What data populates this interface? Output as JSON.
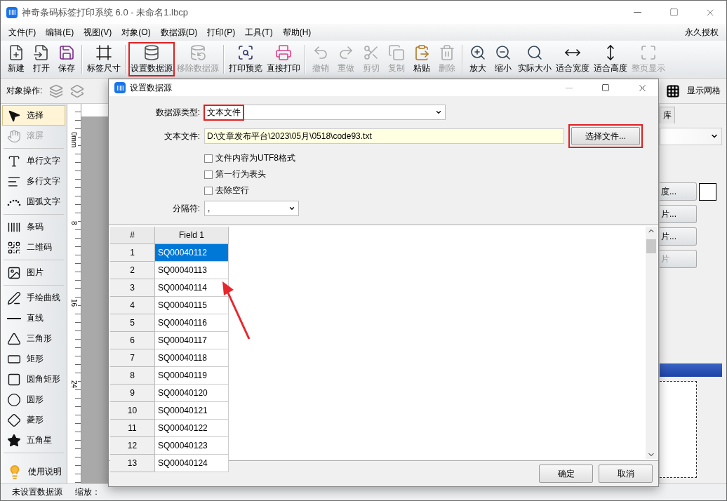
{
  "window": {
    "title": "神奇条码标签打印系统 6.0 - 未命名1.lbcp"
  },
  "menu": [
    "文件(F)",
    "编辑(E)",
    "视图(V)",
    "对象(O)",
    "数据源(D)",
    "打印(P)",
    "工具(T)",
    "帮助(H)"
  ],
  "license": "永久授权",
  "toolbar": [
    {
      "label": "新建",
      "disabled": false,
      "highlighted": false,
      "separator_before": false
    },
    {
      "label": "打开",
      "disabled": false,
      "highlighted": false,
      "separator_before": false
    },
    {
      "label": "保存",
      "disabled": false,
      "highlighted": false,
      "separator_before": false
    },
    {
      "label": "标签尺寸",
      "disabled": false,
      "highlighted": false,
      "separator_before": true
    },
    {
      "label": "设置数据源",
      "disabled": false,
      "highlighted": true,
      "separator_before": true
    },
    {
      "label": "移除数据源",
      "disabled": true,
      "highlighted": false,
      "separator_before": false
    },
    {
      "label": "打印预览",
      "disabled": false,
      "highlighted": false,
      "separator_before": true
    },
    {
      "label": "直接打印",
      "disabled": false,
      "highlighted": false,
      "separator_before": false
    },
    {
      "label": "撤销",
      "disabled": true,
      "highlighted": false,
      "separator_before": true
    },
    {
      "label": "重做",
      "disabled": true,
      "highlighted": false,
      "separator_before": false
    },
    {
      "label": "剪切",
      "disabled": true,
      "highlighted": false,
      "separator_before": false
    },
    {
      "label": "复制",
      "disabled": true,
      "highlighted": false,
      "separator_before": false
    },
    {
      "label": "粘贴",
      "disabled": false,
      "highlighted": false,
      "separator_before": false
    },
    {
      "label": "删除",
      "disabled": true,
      "highlighted": false,
      "separator_before": false
    },
    {
      "label": "放大",
      "disabled": false,
      "highlighted": false,
      "separator_before": true
    },
    {
      "label": "缩小",
      "disabled": false,
      "highlighted": false,
      "separator_before": false
    },
    {
      "label": "实际大小",
      "disabled": false,
      "highlighted": false,
      "separator_before": false
    },
    {
      "label": "适合宽度",
      "disabled": false,
      "highlighted": false,
      "separator_before": false
    },
    {
      "label": "适合高度",
      "disabled": false,
      "highlighted": false,
      "separator_before": false
    },
    {
      "label": "整页显示",
      "disabled": true,
      "highlighted": false,
      "separator_before": false
    }
  ],
  "object_bar": {
    "label": "对象操作:",
    "grid_toggle": "显示网格"
  },
  "tools": [
    {
      "label": "选择",
      "selected": true,
      "disabled": false,
      "separator_before": false
    },
    {
      "label": "滚屏",
      "selected": false,
      "disabled": true,
      "separator_before": false
    },
    {
      "label": "单行文字",
      "selected": false,
      "disabled": false,
      "separator_before": true
    },
    {
      "label": "多行文字",
      "selected": false,
      "disabled": false,
      "separator_before": false
    },
    {
      "label": "圆弧文字",
      "selected": false,
      "disabled": false,
      "separator_before": false
    },
    {
      "label": "条码",
      "selected": false,
      "disabled": false,
      "separator_before": true
    },
    {
      "label": "二维码",
      "selected": false,
      "disabled": false,
      "separator_before": false
    },
    {
      "label": "图片",
      "selected": false,
      "disabled": false,
      "separator_before": true
    },
    {
      "label": "手绘曲线",
      "selected": false,
      "disabled": false,
      "separator_before": true
    },
    {
      "label": "直线",
      "selected": false,
      "disabled": false,
      "separator_before": false
    },
    {
      "label": "三角形",
      "selected": false,
      "disabled": false,
      "separator_before": false
    },
    {
      "label": "矩形",
      "selected": false,
      "disabled": false,
      "separator_before": false
    },
    {
      "label": "圆角矩形",
      "selected": false,
      "disabled": false,
      "separator_before": false
    },
    {
      "label": "圆形",
      "selected": false,
      "disabled": false,
      "separator_before": false
    },
    {
      "label": "菱形",
      "selected": false,
      "disabled": false,
      "separator_before": false
    },
    {
      "label": "五角星",
      "selected": false,
      "disabled": false,
      "separator_before": false
    }
  ],
  "help": "使用说明",
  "ruler_labels": [
    "0mm",
    "8",
    "16",
    "24"
  ],
  "right_panel": {
    "tab": "库",
    "buttons": [
      {
        "label": "度...",
        "disabled": false
      },
      {
        "label": "片...",
        "disabled": false
      },
      {
        "label": "片...",
        "disabled": false
      },
      {
        "label": "片",
        "disabled": true
      }
    ]
  },
  "dialog": {
    "title": "设置数据源",
    "type_label": "数据源类型:",
    "type_value": "文本文件",
    "type_highlighted": true,
    "file_label": "文本文件:",
    "file_path": "D:\\文章发布平台\\2023\\05月\\0518\\code93.txt",
    "choose_button": {
      "label": "选择文件...",
      "highlighted": true
    },
    "options": [
      {
        "label": "文件内容为UTF8格式",
        "checked": false
      },
      {
        "label": "第一行为表头",
        "checked": false
      },
      {
        "label": "去除空行",
        "checked": false
      }
    ],
    "separator_label": "分隔符:",
    "separator_value": ",",
    "table": {
      "columns": [
        "#",
        "Field 1"
      ],
      "rows": [
        {
          "index": "1",
          "value": "SQ00040112",
          "selected": true
        },
        {
          "index": "2",
          "value": "SQ00040113",
          "selected": false
        },
        {
          "index": "3",
          "value": "SQ00040114",
          "selected": false
        },
        {
          "index": "4",
          "value": "SQ00040115",
          "selected": false
        },
        {
          "index": "5",
          "value": "SQ00040116",
          "selected": false
        },
        {
          "index": "6",
          "value": "SQ00040117",
          "selected": false
        },
        {
          "index": "7",
          "value": "SQ00040118",
          "selected": false
        },
        {
          "index": "8",
          "value": "SQ00040119",
          "selected": false
        },
        {
          "index": "9",
          "value": "SQ00040120",
          "selected": false
        },
        {
          "index": "10",
          "value": "SQ00040121",
          "selected": false
        },
        {
          "index": "11",
          "value": "SQ00040122",
          "selected": false
        },
        {
          "index": "12",
          "value": "SQ00040123",
          "selected": false
        },
        {
          "index": "13",
          "value": "SQ00040124",
          "selected": false
        }
      ]
    },
    "buttons": [
      "确定",
      "取消"
    ]
  },
  "status_bar": {
    "text": "未设置数据源",
    "zoom_label": "缩放："
  }
}
